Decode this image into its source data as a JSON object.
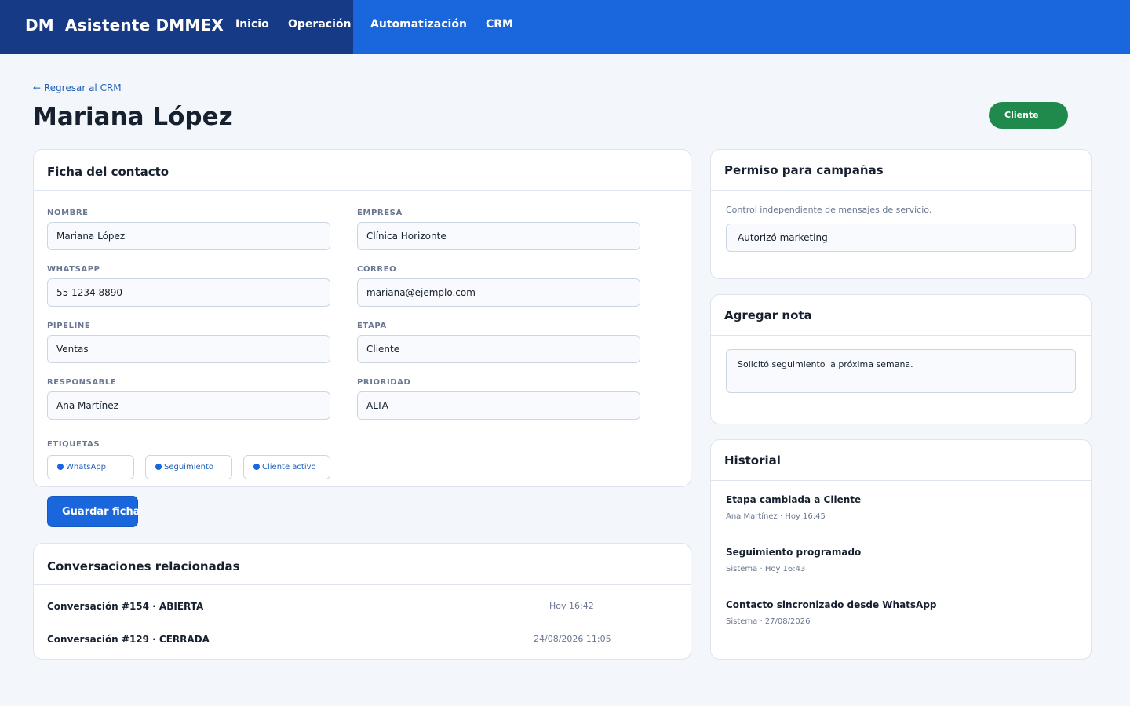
{
  "header": {
    "logo": "DM",
    "app_name": "Asistente DMMEX",
    "nav": [
      "Inicio",
      "Operación",
      "Automatización",
      "CRM"
    ]
  },
  "page": {
    "back_link": "← Regresar al CRM",
    "title": "Mariana López",
    "status_badge": "Cliente"
  },
  "ficha": {
    "heading": "Ficha del contacto",
    "fields": [
      {
        "label": "NOMBRE",
        "value": "Mariana López"
      },
      {
        "label": "EMPRESA",
        "value": "Clínica Horizonte"
      },
      {
        "label": "WHATSAPP",
        "value": "55 1234 8890"
      },
      {
        "label": "CORREO",
        "value": "mariana@ejemplo.com"
      },
      {
        "label": "PIPELINE",
        "value": "Ventas"
      },
      {
        "label": "ETAPA",
        "value": "Cliente"
      },
      {
        "label": "RESPONSABLE",
        "value": "Ana Martínez"
      },
      {
        "label": "PRIORIDAD",
        "value": "ALTA"
      }
    ],
    "tags_label": "ETIQUETAS",
    "tags": [
      "WhatsApp",
      "Seguimiento",
      "Cliente activo"
    ],
    "save_label": "Guardar ficha"
  },
  "conversaciones": {
    "heading": "Conversaciones relacionadas",
    "items": [
      {
        "title": "Conversación #154 · ABIERTA",
        "time": "Hoy 16:42"
      },
      {
        "title": "Conversación #129 · CERRADA",
        "time": "24/08/2026 11:05"
      }
    ]
  },
  "permiso": {
    "heading": "Permiso para campañas",
    "description": "Control independiente de mensajes de servicio.",
    "selected": "Autorizó marketing"
  },
  "nota": {
    "heading": "Agregar nota",
    "value": "Solicitó seguimiento la próxima semana."
  },
  "historial": {
    "heading": "Historial",
    "items": [
      {
        "title": "Etapa cambiada a Cliente",
        "meta": "Ana Martínez · Hoy 16:45"
      },
      {
        "title": "Seguimiento programado",
        "meta": "Sistema · Hoy 16:43"
      },
      {
        "title": "Contacto sincronizado desde WhatsApp",
        "meta": "Sistema · 27/08/2026"
      }
    ]
  },
  "colors": {
    "primary": "#1a66dc",
    "nav_dark": "#163a86",
    "success": "#1f8a4c",
    "background": "#f3f6fb"
  }
}
